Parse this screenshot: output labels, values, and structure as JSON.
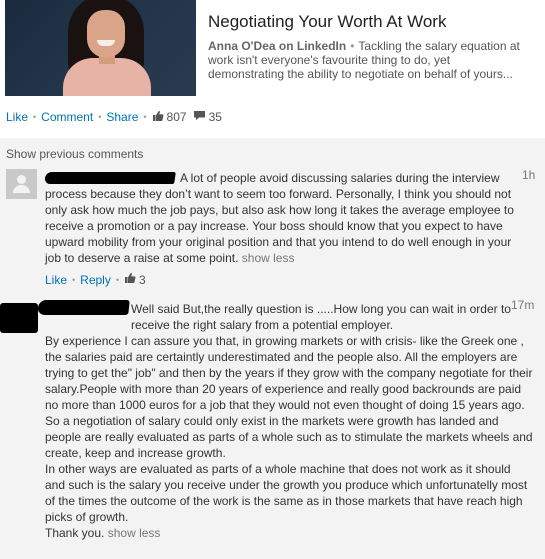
{
  "article": {
    "title": "Negotiating Your Worth At Work",
    "author": "Anna O'Dea on LinkedIn",
    "summary": "Tackling the salary equation at work isn't everyone's favourite thing to do, yet demonstrating the ability to negotiate on behalf of yours..."
  },
  "post_actions": {
    "like": "Like",
    "comment": "Comment",
    "share": "Share",
    "like_count": "807",
    "comment_count": "35"
  },
  "show_previous": "Show previous comments",
  "comments": [
    {
      "time": "1h",
      "text": "A lot of people avoid discussing salaries during the interview process because they don’t want to seem too forward. Personally, I think you should not only ask how much the job pays, but also ask how long it takes the average employee to receive a promotion or a pay increase. Your boss should know that you expect to have upward mobility from your original position and that you intend to do well enough in your job to deserve a raise at some point.",
      "show_less": "show less",
      "like": "Like",
      "reply": "Reply",
      "like_count": "3"
    },
    {
      "time": "17m",
      "paragraphs": [
        "Well said But,the really question is .....How long you can wait in order to receive the right salary from a potential employer.",
        "By experience I can assure you that, in growing markets or with crisis- like the Greek one , the salaries paid are certaintly underestimated and the people also. All the employers are trying to get the\" job\" and then by the years if they grow with the company negotiate for their salary.People with more than 20 years of experience and really good backrounds are paid no more than 1000 euros for a job that they would not even thought of doing 15 years ago.",
        "So a negotiation of salary could only exist in the markets were growth has landed and people are really evaluated as parts of a whole such as to stimulate the markets wheels and create, keep and increase growth.",
        "In other ways are evaluated as parts of a whole machine that does not work as it should and such is the salary you receive under the growth you produce which unfortunatelly most of the times the outcome of the work is the same as in those markets that have reach high picks of growth."
      ],
      "closing": "Thank you.",
      "show_less": "show less"
    }
  ],
  "colors": {
    "link": "#0073b1",
    "band": "#f3f3f3",
    "text": "#333333",
    "muted": "#777777"
  }
}
